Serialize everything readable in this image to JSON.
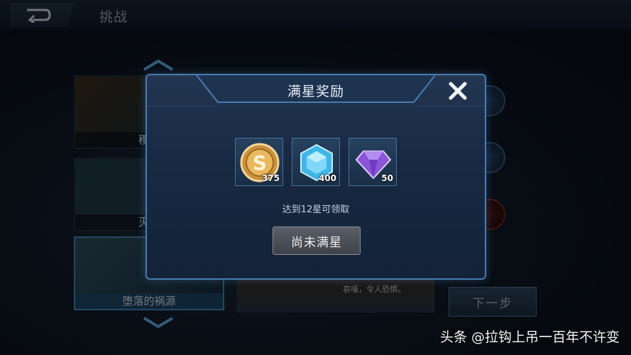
{
  "topbar": {
    "title": "挑战",
    "back_icon": "back-arrow-icon"
  },
  "levels": [
    {
      "label": "稷下"
    },
    {
      "label": "灭国"
    },
    {
      "label": "堕落的祸源"
    }
  ],
  "story": {
    "text": "哀嚎，令人恐惧。"
  },
  "next_button": {
    "label": "下一步"
  },
  "modal": {
    "title": "满星奖励",
    "close_icon": "close-icon",
    "rewards": [
      {
        "icon": "gold-coin-icon",
        "quantity": "375"
      },
      {
        "icon": "blue-crystal-icon",
        "quantity": "400"
      },
      {
        "icon": "purple-diamond-icon",
        "quantity": "50"
      }
    ],
    "hint": "达到12星可领取",
    "status_button": "尚未满星"
  },
  "watermark": "头条 @拉钩上吊一百年不许变",
  "colors": {
    "modal_border": "#4a7bb0",
    "modal_bg": "#1a2c45",
    "button_gray": "#4a4e55"
  }
}
